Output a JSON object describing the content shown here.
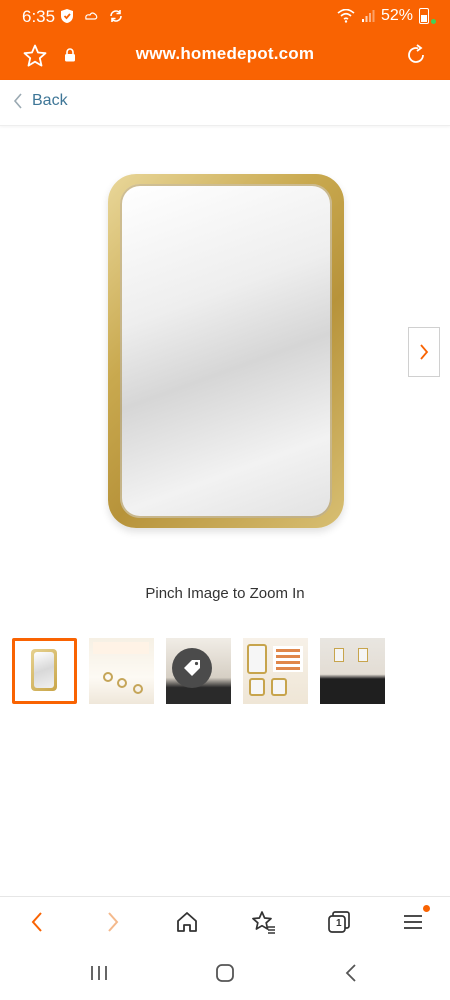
{
  "status_bar": {
    "time": "6:35",
    "battery": "52%"
  },
  "browser": {
    "url": "www.homedepot.com",
    "accent_color": "#f96302"
  },
  "page": {
    "back_label": "Back",
    "zoom_hint": "Pinch Image to Zoom In"
  },
  "gallery": {
    "selected_index": 0,
    "thumbnails": [
      {
        "icon": "mirror-front-view"
      },
      {
        "icon": "mirror-detail-features"
      },
      {
        "icon": "mirror-vanity-scene-tag"
      },
      {
        "icon": "mirror-infographic"
      },
      {
        "icon": "mirror-bathroom-scene"
      }
    ]
  },
  "bottom_nav": {
    "tabs_count": "1"
  }
}
